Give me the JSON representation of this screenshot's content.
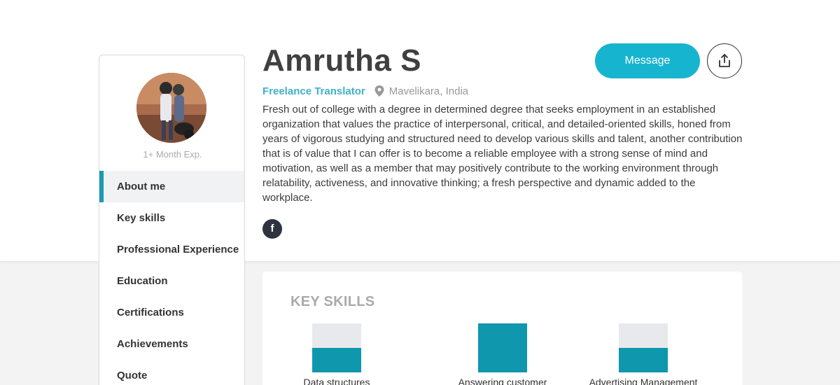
{
  "profile": {
    "name": "Amrutha S",
    "role": "Freelance Translator",
    "location": "Mavelikara, India",
    "experience": "1+ Month Exp.",
    "bio": "Fresh out of college with a degree in determined degree that seeks employment in an established organization that values the practice of interpersonal, critical, and detailed-oriented skills, honed from years of vigorous studying and structured need to develop various skills and talent, another contribution that is of value that I can offer is to become a reliable employee with a strong sense of mind and motivation, as well as a member that may positively contribute to the working environment through relatability, activeness, and innovative thinking; a fresh perspective and dynamic added to the workplace.",
    "social_facebook_glyph": "f"
  },
  "actions": {
    "message_label": "Message",
    "share_icon": "share-icon"
  },
  "sidebar": {
    "items": [
      {
        "label": "About me",
        "active": true
      },
      {
        "label": "Key skills",
        "active": false
      },
      {
        "label": "Professional Experience",
        "active": false
      },
      {
        "label": "Education",
        "active": false
      },
      {
        "label": "Certifications",
        "active": false
      },
      {
        "label": "Achievements",
        "active": false
      },
      {
        "label": "Quote",
        "active": false
      }
    ]
  },
  "skills": {
    "heading": "KEY SKILLS",
    "items": [
      {
        "label": "Data structures",
        "level": 0.5
      },
      {
        "label": "Answering customer",
        "level": 1.0
      },
      {
        "label": "Advertising Management",
        "level": 0.5
      }
    ]
  },
  "colors": {
    "accent": "#17b4cf",
    "skill_fill": "#0f97ae",
    "role_text": "#3fb1c9",
    "active_nav_bar": "#1a9bb0"
  }
}
